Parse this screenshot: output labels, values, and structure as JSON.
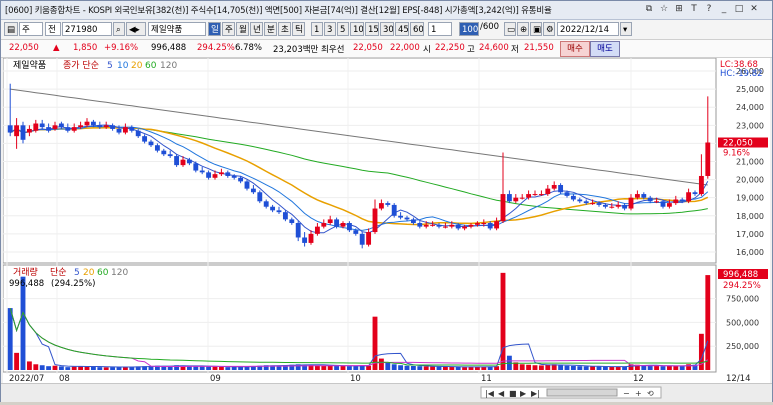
{
  "window": {
    "title": "[0600] 키움종합차트 - KOSPI 외국인보유[382(천)] 주식수[14,705(천)] 액면[500] 자본금[74(억)] 결산[12월] EPS[-848] 시가총액[3,242(억)] 유통비율",
    "controls": [
      "⧉",
      "☆",
      "⊞",
      "T",
      "?",
      "_",
      "□",
      "✕"
    ]
  },
  "toolbar": {
    "mode": "주",
    "market": "전",
    "code": "271980",
    "name": "제일약품",
    "periods": [
      "일",
      "주",
      "월",
      "년",
      "분",
      "초",
      "틱"
    ],
    "active_period": "일",
    "intervals": [
      "1",
      "3",
      "5",
      "10",
      "15",
      "30",
      "45",
      "60"
    ],
    "interval_value": "1",
    "count": "100",
    "count_total": "/600",
    "date": "2022/12/14"
  },
  "price": {
    "close": "22,050",
    "arrow": "▲",
    "change": "1,850",
    "change_pct": "+9.16%",
    "volume": "996,488",
    "volume_pct": "294.25%",
    "turnover": "6.78%",
    "amount": "23,203백만",
    "best_ask_label": "최우선",
    "best_ask": "22,050",
    "best_bid": "22,000",
    "open_label": "시",
    "open": "22,250",
    "high_label": "고",
    "high": "24,600",
    "low_label": "저",
    "low": "21,550",
    "buy_label": "매수",
    "sell_label": "매도"
  },
  "price_panel": {
    "name": "제일약품",
    "legend_prefix": "종가 단순",
    "ma": [
      {
        "period": "5",
        "color": "#3355cc"
      },
      {
        "period": "10",
        "color": "#2277dd"
      },
      {
        "period": "20",
        "color": "#e8a000"
      },
      {
        "period": "60",
        "color": "#22aa22"
      },
      {
        "period": "120",
        "color": "#777777"
      }
    ],
    "lc_label": "LC:38.68",
    "hc_label": "HC:-19.82",
    "current_label": "22,050",
    "current_pct": "9.16%",
    "yticks": [
      "26,000",
      "25,000",
      "24,000",
      "23,000",
      "22,000",
      "21,000",
      "20,000",
      "19,000",
      "18,000",
      "17,000",
      "16,000"
    ]
  },
  "volume_panel": {
    "name": "거래량",
    "legend_prefix": "단순",
    "ma": [
      {
        "period": "5",
        "color": "#3355cc"
      },
      {
        "period": "20",
        "color": "#e8a000"
      },
      {
        "period": "60",
        "color": "#22aa22"
      },
      {
        "period": "120",
        "color": "#777777"
      }
    ],
    "value_label": "996,488",
    "value_pct": "(294.25%)",
    "right_label": "996,488",
    "right_pct": "294.25%",
    "yticks": [
      "750,000",
      "500,000",
      "250,000"
    ]
  },
  "xaxis": {
    "labels": [
      "2022/07",
      "08",
      "09",
      "10",
      "11",
      "12"
    ],
    "right": "12/14"
  },
  "colors": {
    "up": "#e3001b",
    "down": "#1f4fd6",
    "ma5": "#3355cc",
    "ma20": "#e8a000",
    "ma60": "#22aa22",
    "ma120": "#777777"
  },
  "chart_data": {
    "type": "candlestick",
    "close": [
      22600,
      23000,
      22200,
      22800,
      23100,
      22900,
      22700,
      23000,
      22900,
      22700,
      22900,
      23000,
      23200,
      23000,
      22900,
      23000,
      22800,
      22600,
      22900,
      22700,
      22400,
      22100,
      21900,
      21600,
      21400,
      21300,
      20800,
      21100,
      20900,
      20500,
      20400,
      20100,
      20300,
      20400,
      20200,
      20100,
      19900,
      19500,
      19300,
      18800,
      18500,
      18300,
      18200,
      17800,
      17600,
      16800,
      16500,
      17000,
      17400,
      17600,
      17800,
      17400,
      17600,
      17200,
      17000,
      16400,
      17100,
      18400,
      18700,
      18600,
      18000,
      17900,
      17800,
      17600,
      17400,
      17500,
      17500,
      17400,
      17400,
      17500,
      17300,
      17400,
      17500,
      17600,
      17600,
      17300,
      17700,
      19200,
      18800,
      19000,
      19000,
      19200,
      19200,
      19200,
      19500,
      19700,
      19300,
      19100,
      18900,
      18800,
      18700,
      18700,
      18600,
      18500,
      18500,
      18600,
      18400,
      19000,
      19200,
      19000,
      18800,
      18800,
      18500,
      18700,
      18900,
      18800,
      19300,
      19200,
      20200,
      22050
    ],
    "open": [
      23000,
      22400,
      23000,
      22600,
      22700,
      23100,
      22900,
      22800,
      23100,
      22900,
      22700,
      22900,
      23000,
      23200,
      23000,
      22900,
      23000,
      22800,
      22600,
      22900,
      22700,
      22400,
      22100,
      21900,
      21600,
      21400,
      21300,
      20800,
      21100,
      20900,
      20500,
      20400,
      20100,
      20300,
      20400,
      20200,
      20100,
      19900,
      19500,
      19300,
      18800,
      18500,
      18300,
      18200,
      17800,
      17600,
      16800,
      16500,
      17000,
      17400,
      17600,
      17800,
      17400,
      17600,
      17200,
      17000,
      16400,
      17100,
      18400,
      18700,
      18600,
      18000,
      17900,
      17800,
      17600,
      17400,
      17500,
      17500,
      17400,
      17400,
      17500,
      17300,
      17400,
      17500,
      17600,
      17600,
      17300,
      17700,
      19200,
      18800,
      19000,
      19000,
      19200,
      19200,
      19200,
      19500,
      19700,
      19300,
      19100,
      18900,
      18800,
      18700,
      18700,
      18600,
      18500,
      18500,
      18600,
      18400,
      19000,
      19200,
      19000,
      18800,
      18800,
      18500,
      18700,
      18900,
      18800,
      19300,
      19200,
      20200
    ],
    "high": [
      25300,
      23400,
      23200,
      23000,
      23300,
      23300,
      23100,
      23200,
      23200,
      23100,
      23100,
      23200,
      23400,
      23300,
      23200,
      23200,
      23100,
      23000,
      23100,
      23000,
      22800,
      22500,
      22200,
      22000,
      21700,
      21600,
      21400,
      21300,
      21200,
      21000,
      20700,
      20500,
      20500,
      20600,
      20500,
      20300,
      20200,
      20000,
      19700,
      19400,
      18900,
      18600,
      18500,
      18300,
      17900,
      17700,
      17100,
      17200,
      17600,
      17800,
      18000,
      17900,
      17700,
      17700,
      17300,
      17100,
      17300,
      18900,
      18900,
      18800,
      18700,
      18200,
      18000,
      17900,
      17700,
      17700,
      17700,
      17600,
      17600,
      17700,
      17600,
      17500,
      17600,
      17700,
      17800,
      17700,
      17900,
      21500,
      19400,
      19200,
      19200,
      19400,
      19400,
      19400,
      19700,
      19900,
      19800,
      19400,
      19200,
      19000,
      18900,
      18900,
      18800,
      18700,
      18700,
      18800,
      18700,
      19200,
      19400,
      19300,
      19100,
      19000,
      18900,
      18900,
      19100,
      19000,
      19500,
      19400,
      21400,
      24600
    ],
    "low": [
      22400,
      21700,
      22000,
      22400,
      22600,
      22800,
      22600,
      22700,
      22800,
      22600,
      22600,
      22800,
      22900,
      22900,
      22800,
      22800,
      22700,
      22500,
      22500,
      22600,
      22300,
      22000,
      21800,
      21500,
      21300,
      21200,
      20700,
      20700,
      20800,
      20400,
      20300,
      20000,
      20000,
      20200,
      20100,
      20000,
      19800,
      19400,
      19200,
      18700,
      18400,
      18200,
      18100,
      17700,
      17500,
      16600,
      16300,
      16400,
      16900,
      17300,
      17500,
      17300,
      17300,
      17100,
      16900,
      16200,
      16300,
      17000,
      18300,
      18500,
      17900,
      17800,
      17700,
      17500,
      17300,
      17300,
      17400,
      17300,
      17300,
      17300,
      17200,
      17200,
      17300,
      17400,
      17400,
      17200,
      17200,
      17600,
      18700,
      18700,
      18900,
      18900,
      19100,
      19100,
      19100,
      19400,
      19200,
      19000,
      18800,
      18700,
      18600,
      18600,
      18500,
      18400,
      18400,
      18400,
      18300,
      18300,
      18900,
      18900,
      18700,
      18700,
      18400,
      18400,
      18600,
      18700,
      18700,
      19100,
      19100,
      20050
    ],
    "volume": [
      650000,
      180000,
      980000,
      90000,
      60000,
      50000,
      40000,
      45000,
      38000,
      30000,
      35000,
      40000,
      42000,
      35000,
      30000,
      28000,
      30000,
      35000,
      32000,
      30000,
      38000,
      40000,
      42000,
      45000,
      40000,
      38000,
      50000,
      45000,
      42000,
      40000,
      38000,
      40000,
      35000,
      33000,
      30000,
      32000,
      35000,
      40000,
      42000,
      45000,
      50000,
      48000,
      45000,
      50000,
      55000,
      60000,
      58000,
      55000,
      50000,
      48000,
      45000,
      45000,
      42000,
      40000,
      38000,
      50000,
      45000,
      560000,
      120000,
      80000,
      60000,
      50000,
      45000,
      42000,
      40000,
      38000,
      36000,
      35000,
      34000,
      33000,
      32000,
      30000,
      32000,
      34000,
      36000,
      35000,
      40000,
      1020000,
      150000,
      80000,
      60000,
      55000,
      50000,
      48000,
      55000,
      60000,
      50000,
      45000,
      42000,
      40000,
      38000,
      37000,
      36000,
      35000,
      34000,
      35000,
      36000,
      60000,
      55000,
      50000,
      45000,
      42000,
      40000,
      42000,
      45000,
      44000,
      60000,
      55000,
      380000,
      996488
    ],
    "ylim": [
      15500,
      26500
    ],
    "x_labels": [
      "2022/07",
      "08",
      "09",
      "10",
      "11",
      "12",
      "12/14"
    ]
  }
}
